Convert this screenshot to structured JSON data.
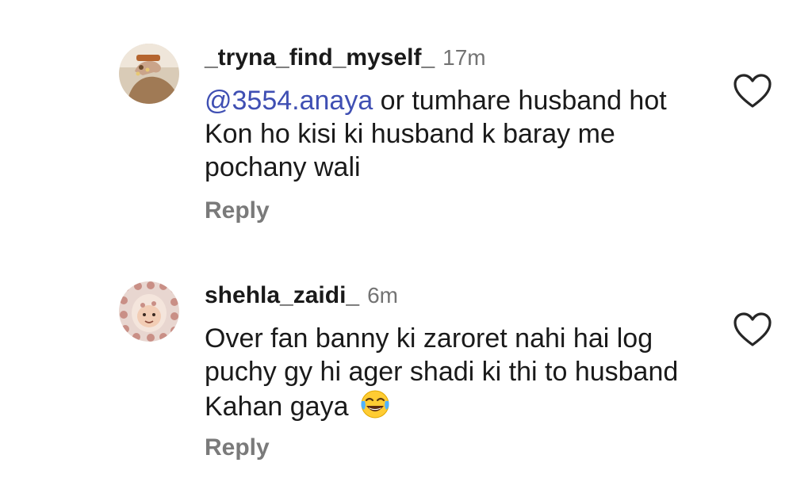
{
  "comments": [
    {
      "username": "_tryna_find_myself_",
      "time": "17m",
      "mention": "@3554.anaya",
      "text": " or tumhare husband hot Kon ho kisi ki husband k baray me pochany wali",
      "reply_label": "Reply",
      "avatar_icon": "avatar-photo-hands",
      "like_icon": "heart-outline-icon"
    },
    {
      "username": "shehla_zaidi_",
      "time": "6m",
      "text": "Over fan banny ki zaroret nahi hai log puchy gy hi ager shadi ki thi to husband Kahan gaya",
      "emoji_icon": "face-with-tears-of-joy-icon",
      "reply_label": "Reply",
      "avatar_icon": "avatar-photo-baby",
      "like_icon": "heart-outline-icon"
    }
  ],
  "colors": {
    "mention": "#3f4fb3",
    "timestamp": "#737373",
    "reply": "#7a7a7a",
    "text": "#1a1a1a"
  }
}
